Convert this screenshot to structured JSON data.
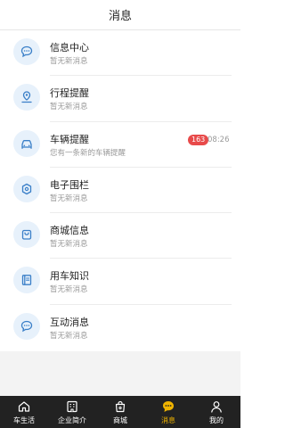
{
  "header": {
    "title": "消息"
  },
  "messages": [
    {
      "icon": "chat-bubble-icon",
      "title": "信息中心",
      "subtitle": "暂无新消息"
    },
    {
      "icon": "location-pin-icon",
      "title": "行程提醒",
      "subtitle": "暂无新消息"
    },
    {
      "icon": "car-icon",
      "title": "车辆提醒",
      "subtitle": "您有一条新的车辆提醒",
      "badge": "163",
      "time": "08:26"
    },
    {
      "icon": "geofence-icon",
      "title": "电子围栏",
      "subtitle": "暂无新消息"
    },
    {
      "icon": "shopping-bag-icon",
      "title": "商城信息",
      "subtitle": "暂无新消息"
    },
    {
      "icon": "book-icon",
      "title": "用车知识",
      "subtitle": "暂无新消息"
    },
    {
      "icon": "chat-bubble-icon",
      "title": "互动消息",
      "subtitle": "暂无新消息"
    }
  ],
  "tabbar": {
    "tabs": [
      {
        "icon": "home-icon",
        "label": "车生活",
        "active": false
      },
      {
        "icon": "company-icon",
        "label": "企业简介",
        "active": false
      },
      {
        "icon": "shop-bag-icon",
        "label": "商城",
        "active": false
      },
      {
        "icon": "message-icon",
        "label": "消息",
        "active": true
      },
      {
        "icon": "user-icon",
        "label": "我的",
        "active": false
      }
    ]
  },
  "colors": {
    "icon_bg": "#e7f1fb",
    "icon_stroke": "#3a7fc8",
    "tabbar_bg": "#222222",
    "tab_active": "#f0b400",
    "badge": "#e84a4a"
  }
}
